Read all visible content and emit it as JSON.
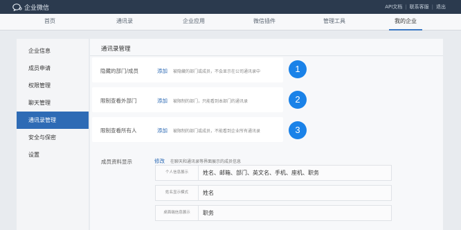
{
  "app": {
    "name": "企业微信"
  },
  "toplinks": [
    "API文档",
    "联系客服",
    "退出"
  ],
  "nav": [
    "首页",
    "通讯录",
    "企业应用",
    "微信插件",
    "管理工具",
    "我的企业"
  ],
  "sidebar": [
    "企业信息",
    "成员申请",
    "权限管理",
    "聊天管理",
    "通讯录管理",
    "安全与保密",
    "设置"
  ],
  "content": {
    "title": "通讯录管理",
    "cards": [
      {
        "label": "隐藏的部门/成员",
        "action": "添加",
        "desc": "被隐藏的部门或成员，不会显示在公司通讯录中",
        "badge": "1"
      },
      {
        "label": "限制查看外部门",
        "action": "添加",
        "desc": "被限制的部门，只能看到本部门的通讯录",
        "badge": "2"
      },
      {
        "label": "限制查看所有人",
        "action": "添加",
        "desc": "被限制的部门或成员，不能看到企业所有通讯录",
        "badge": "3"
      }
    ],
    "profile": {
      "label": "成员资料显示",
      "action": "修改",
      "desc": "在聊天和通讯录等界面展示的成员信息",
      "fields": [
        {
          "label": "个人信息展示",
          "value": "姓名、邮箱、部门、英文名、手机、座机、职务"
        },
        {
          "label": "姓名显示模式",
          "value": "姓名"
        },
        {
          "label": "桌面端信息展示",
          "value": "职务"
        }
      ]
    }
  },
  "colors": {
    "topbar": "#2b3a4e",
    "accent": "#2e6bb5",
    "badge": "#1a82e8"
  }
}
